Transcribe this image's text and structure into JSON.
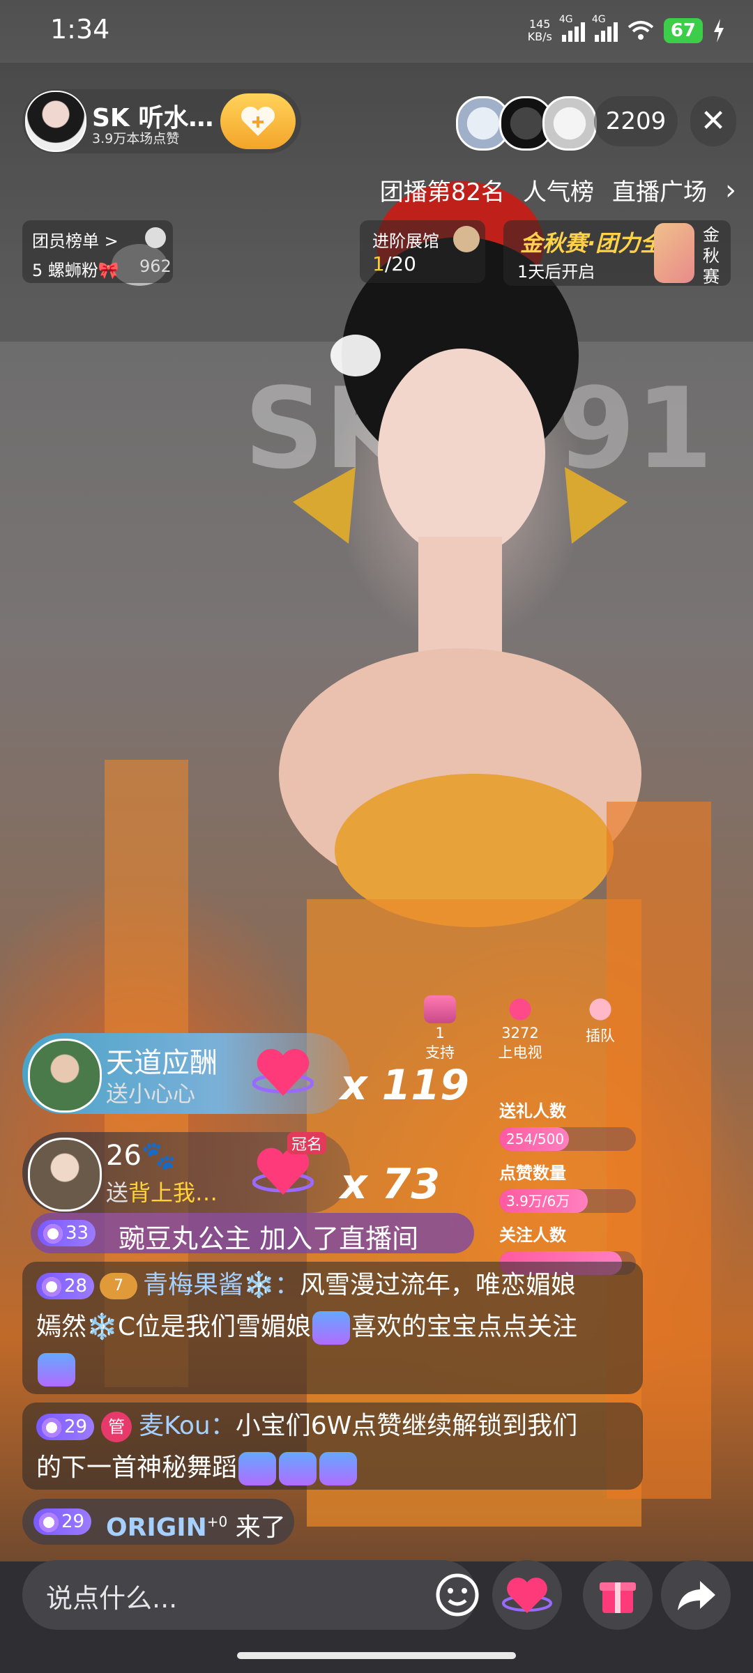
{
  "status_bar": {
    "time": "1:34",
    "net_speed": "145",
    "net_unit": "KB/s",
    "sig1": "4G",
    "sig2": "4G",
    "battery": "67"
  },
  "header": {
    "host_name": "SK 听水…",
    "host_likes": "3.9万本场点赞",
    "follow_icon": "heart-plus-icon",
    "viewer_count": "2209",
    "close_label": "✕"
  },
  "rank_row": {
    "rank": "团播第82名",
    "popularity": "人气榜",
    "plaza": "直播广场",
    "chevron": "›"
  },
  "member_card": {
    "title": "团员榜单 >",
    "fan_line": "5 螺蛳粉🎀",
    "count": "962"
  },
  "gallery_card": {
    "title": "进阶展馆",
    "current": "1",
    "total": "/20"
  },
  "event_card": {
    "title": "金秋赛·团力全开",
    "subtitle": "1天后开启",
    "side": "金秋赛"
  },
  "widgets": [
    {
      "count": "1",
      "label": "支持"
    },
    {
      "count": "3272",
      "label": "上电视"
    },
    {
      "count": "",
      "label": "插队"
    }
  ],
  "stats": [
    {
      "label": "送礼人数",
      "value": "254/500",
      "fraction": 0.508
    },
    {
      "label": "点赞数量",
      "value": "3.9万/6万",
      "fraction": 0.65
    },
    {
      "label": "关注人数",
      "value": "",
      "fraction": 0.9
    }
  ],
  "gifts": [
    {
      "name": "天道应酬",
      "prefix": "送",
      "item": "小心心",
      "multiplier": "x 119"
    },
    {
      "name": "26🐾",
      "prefix": "送",
      "item": "背上我…",
      "multiplier": "x 73",
      "tag": "冠名"
    }
  ],
  "join": {
    "level": "33",
    "text": "豌豆丸公主 加入了直播间"
  },
  "chat": [
    {
      "level": "28",
      "fan_level": "7",
      "user": "青梅果酱❄️：",
      "line1": "风雪漫过流年，唯恋媚娘",
      "line2a": "嫣然❄️C位是我们雪媚娘",
      "line2b": "喜欢的宝宝点点关注"
    },
    {
      "level": "29",
      "admin": "管",
      "user": "麦Kou：",
      "line1": "小宝们6W点赞继续解锁到我们",
      "line2": "的下一首神秘舞蹈"
    }
  ],
  "arrive": {
    "level": "29",
    "user": "ORIGIN",
    "sup": "+0",
    "text": "来了"
  },
  "bottom": {
    "placeholder": "说点什么..."
  },
  "colors": {
    "accent_pink": "#ff5aa0",
    "level_purple": "#7a5aff",
    "username_blue": "#a5d0ff",
    "gold": "#ffd24a",
    "battery_green": "#3ccd49"
  }
}
